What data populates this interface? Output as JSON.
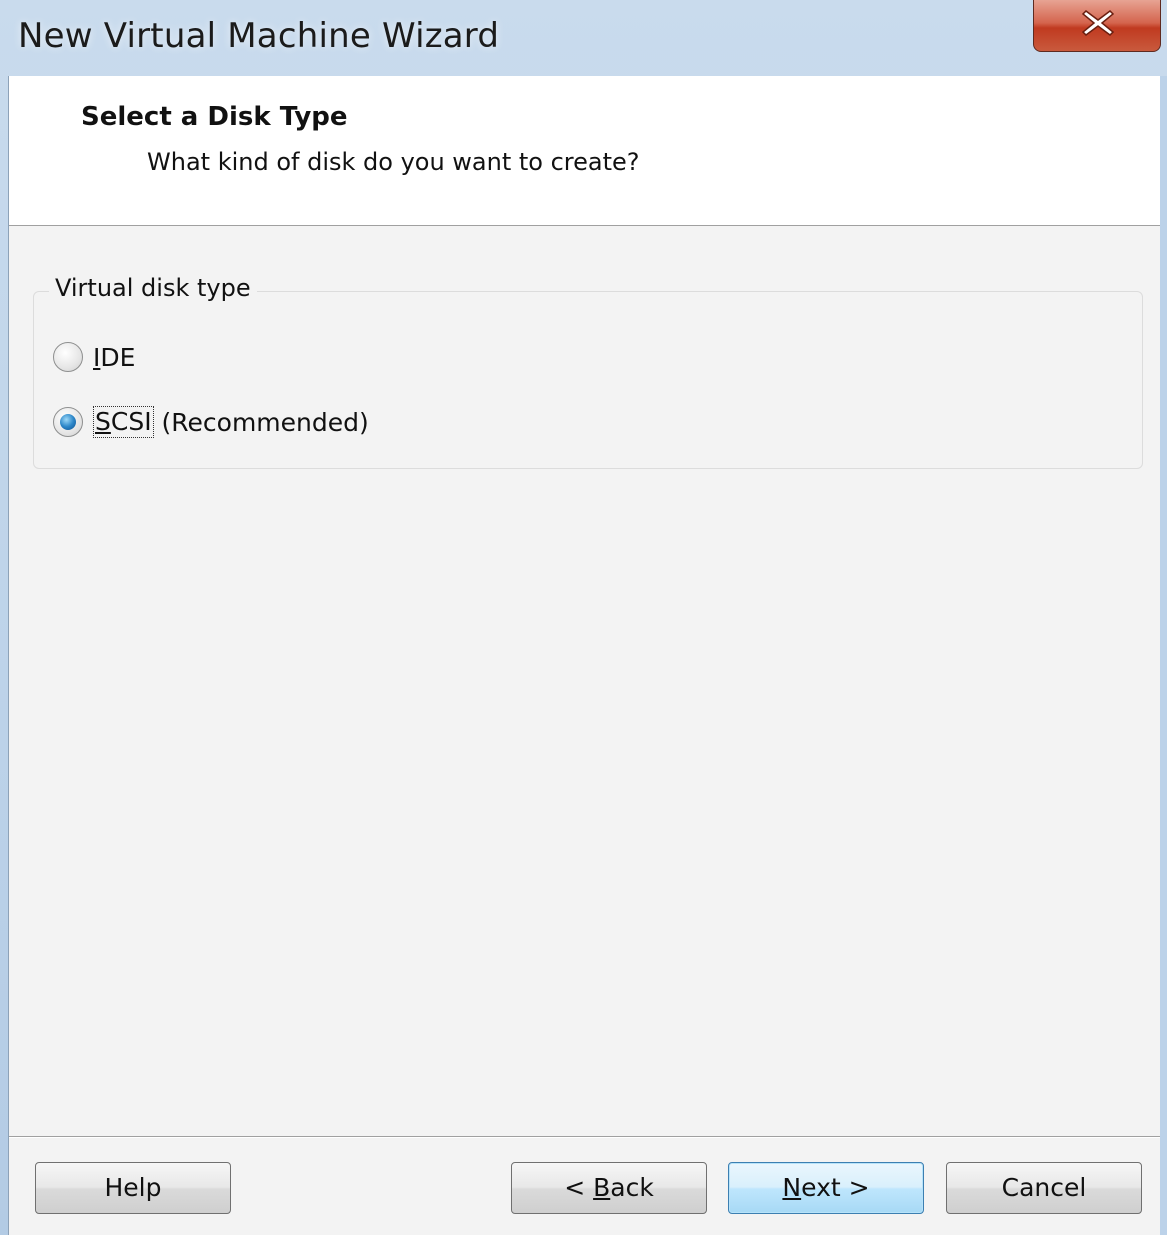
{
  "window": {
    "title": "New Virtual Machine Wizard",
    "close_icon": "close-icon"
  },
  "header": {
    "title": "Select a Disk Type",
    "subtitle": "What kind of disk do you want to create?"
  },
  "disk_type_group": {
    "label": "Virtual disk type",
    "options": [
      {
        "mnemonic": "I",
        "rest": "DE",
        "suffix": "",
        "selected": false
      },
      {
        "mnemonic": "S",
        "rest": "CSI",
        "suffix": " (Recommended)",
        "selected": true
      }
    ]
  },
  "buttons": {
    "help": "Help",
    "back_prefix": "< ",
    "back_mnemonic": "B",
    "back_rest": "ack",
    "next_mnemonic": "N",
    "next_rest": "ext >",
    "cancel": "Cancel"
  },
  "colors": {
    "selected_radio": "#2d87c9",
    "close_button": "#c03a20",
    "default_button_border": "#3c7fb1"
  }
}
